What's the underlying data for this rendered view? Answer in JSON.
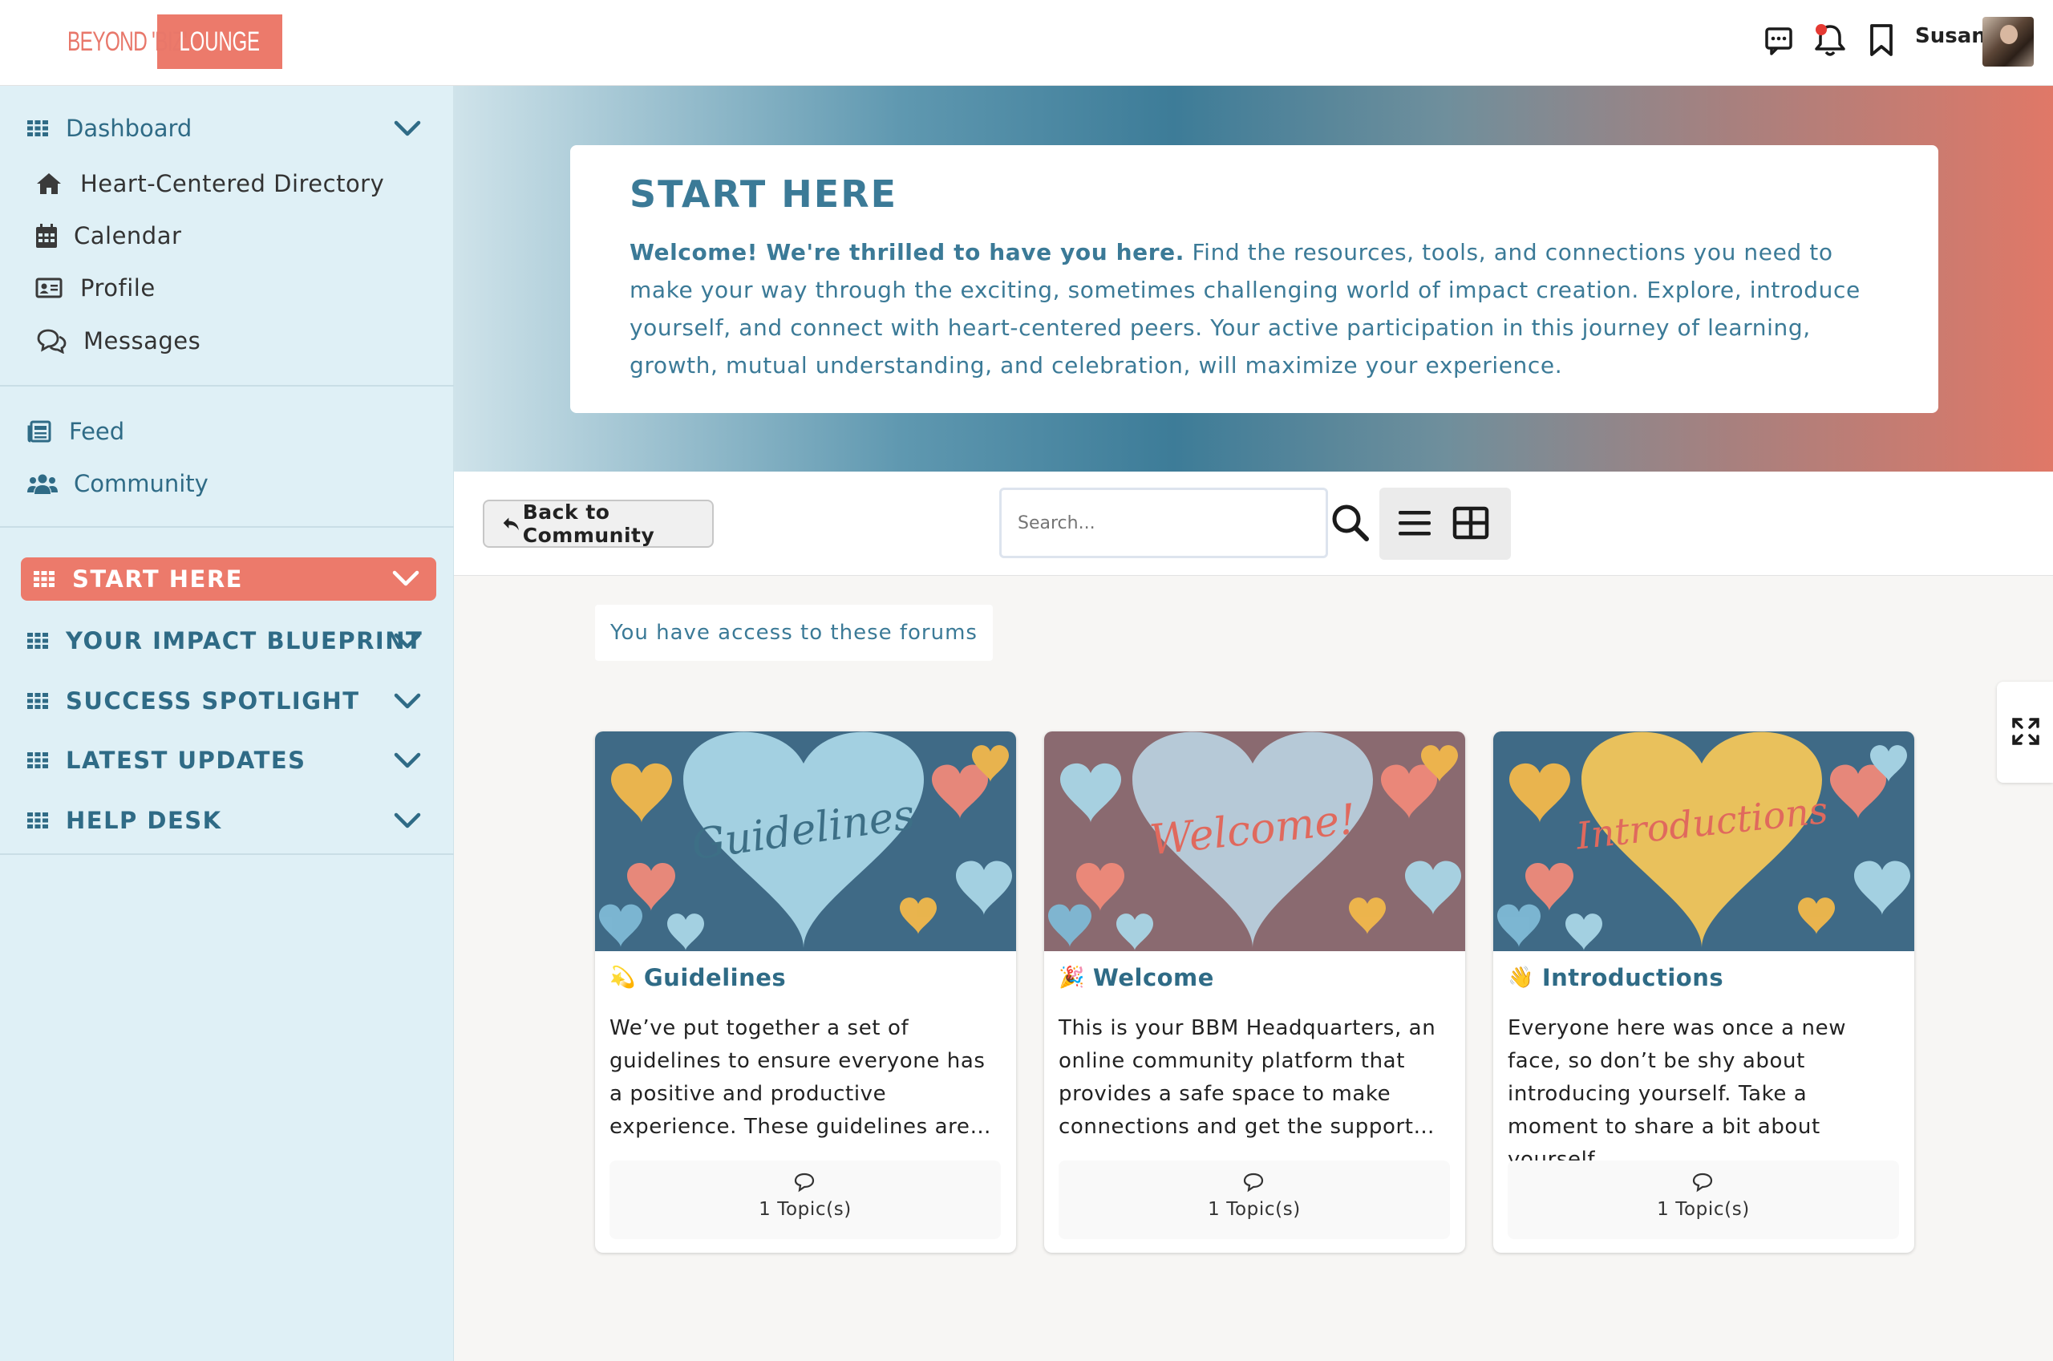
{
  "header": {
    "logo_part1": "BEYOND 'BIZ'",
    "logo_part2": "LOUNGE",
    "user_name": "Susan",
    "icons": [
      "message-icon",
      "bell-icon",
      "bookmark-icon"
    ]
  },
  "sidebar": {
    "dashboard": "Dashboard",
    "sub_items": [
      {
        "label": "Heart-Centered Directory",
        "icon": "home-icon"
      },
      {
        "label": "Calendar",
        "icon": "calendar-icon"
      },
      {
        "label": "Profile",
        "icon": "profile-card-icon"
      },
      {
        "label": "Messages",
        "icon": "messages-icon"
      }
    ],
    "feed": "Feed",
    "community": "Community",
    "sections": [
      {
        "label": "START HERE",
        "active": true
      },
      {
        "label": "YOUR IMPACT BLUEPRINT",
        "active": false
      },
      {
        "label": "SUCCESS SPOTLIGHT",
        "active": false
      },
      {
        "label": "LATEST UPDATES",
        "active": false
      },
      {
        "label": "HELP DESK",
        "active": false
      }
    ]
  },
  "hero": {
    "title": "START HERE",
    "intro_bold": "Welcome! We're thrilled to have you here.",
    "intro_rest": " Find the resources, tools, and connections you need to make your way through the exciting, sometimes challenging world of impact creation. Explore, introduce yourself, and connect with heart-centered peers. Your active participation in this journey of learning, growth, mutual understanding, and celebration, will maximize your experience."
  },
  "toolbar": {
    "back_label": "Back to Community",
    "search_placeholder": "Search..."
  },
  "main": {
    "access_note": "You have access to these forums",
    "forums": [
      {
        "emoji": "💫",
        "title": "Guidelines",
        "image_text": "Guidelines",
        "heart_color": "#a9d6e6",
        "script_color": "#3d6f86",
        "description": "We’ve put together a set of guidelines to ensure everyone has a positive and productive experience. These guidelines are…",
        "topics": "1 Topic(s)"
      },
      {
        "emoji": "🎉",
        "title": "Welcome",
        "image_text": "Welcome!",
        "heart_color": "#b8cfdc",
        "script_color": "#e0695d",
        "description": "This is your BBM Headquarters, an online community platform that provides a safe space to make connections and get the support…",
        "topics": "1 Topic(s)"
      },
      {
        "emoji": "👋",
        "title": "Introductions",
        "image_text": "Introductions",
        "heart_color": "#f2c65a",
        "script_color": "#e0695d",
        "description": "Everyone here was once a new face, so don’t be shy about introducing yourself. Take a moment to share a bit about yourself…",
        "topics": "1 Topic(s)"
      }
    ]
  },
  "colors": {
    "accent": "#ec7a6b",
    "primary_text": "#2f6b86",
    "sidebar_bg": "#dff0f6"
  }
}
